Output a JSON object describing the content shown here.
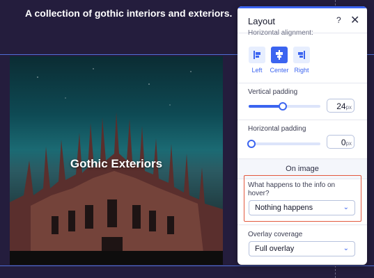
{
  "canvas": {
    "heading": "A collection of gothic interiors and exteriors.",
    "image_caption": "Gothic Exteriors"
  },
  "panel": {
    "title": "Layout",
    "help_icon": "?",
    "close_icon": "✕",
    "horizontal_alignment": {
      "label": "Horizontal alignment:",
      "options": [
        "Left",
        "Center",
        "Right"
      ],
      "selected": "Center"
    },
    "vertical_padding": {
      "label": "Vertical padding",
      "value": "24",
      "unit": "px",
      "fraction": 0.5
    },
    "horizontal_padding": {
      "label": "Horizontal padding",
      "value": "0",
      "unit": "px",
      "fraction": 0
    },
    "on_image": {
      "label": "On image"
    },
    "hover_info": {
      "label": "What happens to the info on hover?",
      "selected": "Nothing happens"
    },
    "overlay_coverage": {
      "label": "Overlay coverage",
      "selected": "Full overlay"
    },
    "colors": {
      "accent": "#3b64f0",
      "highlight_border": "#e2583e",
      "canvas_bg": "#241d3d"
    }
  }
}
